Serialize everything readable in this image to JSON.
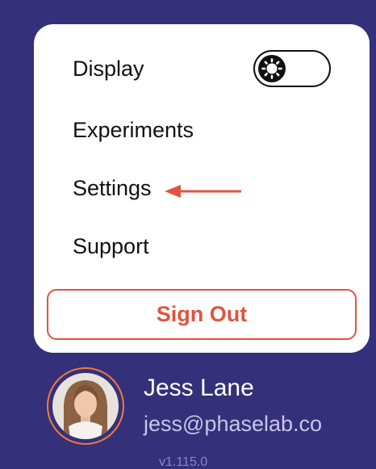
{
  "menu": {
    "items": [
      {
        "label": "Display"
      },
      {
        "label": "Experiments"
      },
      {
        "label": "Settings"
      },
      {
        "label": "Support"
      }
    ],
    "display_toggle": {
      "state": "off",
      "icon": "sun-icon"
    },
    "annotation": {
      "icon": "arrow-left-icon",
      "points_to": "Settings"
    },
    "sign_out_label": "Sign Out"
  },
  "user": {
    "name": "Jess Lane",
    "email": "jess@phaselab.co"
  },
  "version": "v1.115.0",
  "colors": {
    "background": "#35307a",
    "card": "#ffffff",
    "accent": "#e2533e",
    "avatar_ring": "#ef7a39",
    "email_text": "#c8c5e7"
  }
}
